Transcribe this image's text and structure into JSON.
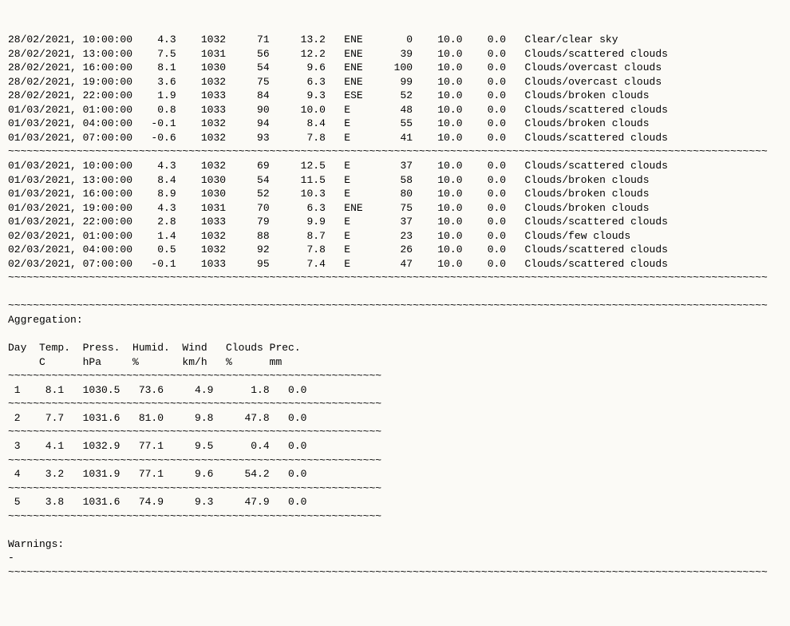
{
  "rowsA": [
    {
      "date": "28/02/2021,",
      "time": "10:00:00",
      "t": "4.3",
      "p": "1032",
      "h": "71",
      "w": "13.2",
      "dir": "ENE",
      "c": "0",
      "v": "10.0",
      "r": "0.0",
      "cond": "Clear/clear sky"
    },
    {
      "date": "28/02/2021,",
      "time": "13:00:00",
      "t": "7.5",
      "p": "1031",
      "h": "56",
      "w": "12.2",
      "dir": "ENE",
      "c": "39",
      "v": "10.0",
      "r": "0.0",
      "cond": "Clouds/scattered clouds"
    },
    {
      "date": "28/02/2021,",
      "time": "16:00:00",
      "t": "8.1",
      "p": "1030",
      "h": "54",
      "w": "9.6",
      "dir": "ENE",
      "c": "100",
      "v": "10.0",
      "r": "0.0",
      "cond": "Clouds/overcast clouds"
    },
    {
      "date": "28/02/2021,",
      "time": "19:00:00",
      "t": "3.6",
      "p": "1032",
      "h": "75",
      "w": "6.3",
      "dir": "ENE",
      "c": "99",
      "v": "10.0",
      "r": "0.0",
      "cond": "Clouds/overcast clouds"
    },
    {
      "date": "28/02/2021,",
      "time": "22:00:00",
      "t": "1.9",
      "p": "1033",
      "h": "84",
      "w": "9.3",
      "dir": "ESE",
      "c": "52",
      "v": "10.0",
      "r": "0.0",
      "cond": "Clouds/broken clouds"
    },
    {
      "date": "01/03/2021,",
      "time": "01:00:00",
      "t": "0.8",
      "p": "1033",
      "h": "90",
      "w": "10.0",
      "dir": "E",
      "c": "48",
      "v": "10.0",
      "r": "0.0",
      "cond": "Clouds/scattered clouds"
    },
    {
      "date": "01/03/2021,",
      "time": "04:00:00",
      "t": "-0.1",
      "p": "1032",
      "h": "94",
      "w": "8.4",
      "dir": "E",
      "c": "55",
      "v": "10.0",
      "r": "0.0",
      "cond": "Clouds/broken clouds"
    },
    {
      "date": "01/03/2021,",
      "time": "07:00:00",
      "t": "-0.6",
      "p": "1032",
      "h": "93",
      "w": "7.8",
      "dir": "E",
      "c": "41",
      "v": "10.0",
      "r": "0.0",
      "cond": "Clouds/scattered clouds"
    }
  ],
  "rowsB": [
    {
      "date": "01/03/2021,",
      "time": "10:00:00",
      "t": "4.3",
      "p": "1032",
      "h": "69",
      "w": "12.5",
      "dir": "E",
      "c": "37",
      "v": "10.0",
      "r": "0.0",
      "cond": "Clouds/scattered clouds"
    },
    {
      "date": "01/03/2021,",
      "time": "13:00:00",
      "t": "8.4",
      "p": "1030",
      "h": "54",
      "w": "11.5",
      "dir": "E",
      "c": "58",
      "v": "10.0",
      "r": "0.0",
      "cond": "Clouds/broken clouds"
    },
    {
      "date": "01/03/2021,",
      "time": "16:00:00",
      "t": "8.9",
      "p": "1030",
      "h": "52",
      "w": "10.3",
      "dir": "E",
      "c": "80",
      "v": "10.0",
      "r": "0.0",
      "cond": "Clouds/broken clouds"
    },
    {
      "date": "01/03/2021,",
      "time": "19:00:00",
      "t": "4.3",
      "p": "1031",
      "h": "70",
      "w": "6.3",
      "dir": "ENE",
      "c": "75",
      "v": "10.0",
      "r": "0.0",
      "cond": "Clouds/broken clouds"
    },
    {
      "date": "01/03/2021,",
      "time": "22:00:00",
      "t": "2.8",
      "p": "1033",
      "h": "79",
      "w": "9.9",
      "dir": "E",
      "c": "37",
      "v": "10.0",
      "r": "0.0",
      "cond": "Clouds/scattered clouds"
    },
    {
      "date": "02/03/2021,",
      "time": "01:00:00",
      "t": "1.4",
      "p": "1032",
      "h": "88",
      "w": "8.7",
      "dir": "E",
      "c": "23",
      "v": "10.0",
      "r": "0.0",
      "cond": "Clouds/few clouds"
    },
    {
      "date": "02/03/2021,",
      "time": "04:00:00",
      "t": "0.5",
      "p": "1032",
      "h": "92",
      "w": "7.8",
      "dir": "E",
      "c": "26",
      "v": "10.0",
      "r": "0.0",
      "cond": "Clouds/scattered clouds"
    },
    {
      "date": "02/03/2021,",
      "time": "07:00:00",
      "t": "-0.1",
      "p": "1033",
      "h": "95",
      "w": "7.4",
      "dir": "E",
      "c": "47",
      "v": "10.0",
      "r": "0.0",
      "cond": "Clouds/scattered clouds"
    }
  ],
  "aggTitle": "Aggregation:",
  "aggHead1": "Day  Temp.  Press.  Humid.  Wind   Clouds Prec.",
  "aggHead2": "     C      hPa     %       km/h   %      mm",
  "agg": [
    {
      "d": "1",
      "t": "8.1",
      "p": "1030.5",
      "h": "73.6",
      "w": "4.9",
      "c": "1.8",
      "r": "0.0"
    },
    {
      "d": "2",
      "t": "7.7",
      "p": "1031.6",
      "h": "81.0",
      "w": "9.8",
      "c": "47.8",
      "r": "0.0"
    },
    {
      "d": "3",
      "t": "4.1",
      "p": "1032.9",
      "h": "77.1",
      "w": "9.5",
      "c": "0.4",
      "r": "0.0"
    },
    {
      "d": "4",
      "t": "3.2",
      "p": "1031.9",
      "h": "77.1",
      "w": "9.6",
      "c": "54.2",
      "r": "0.0"
    },
    {
      "d": "5",
      "t": "3.8",
      "p": "1031.6",
      "h": "74.9",
      "w": "9.3",
      "c": "47.9",
      "r": "0.0"
    }
  ],
  "warnTitle": "Warnings:",
  "warnBody": "-"
}
